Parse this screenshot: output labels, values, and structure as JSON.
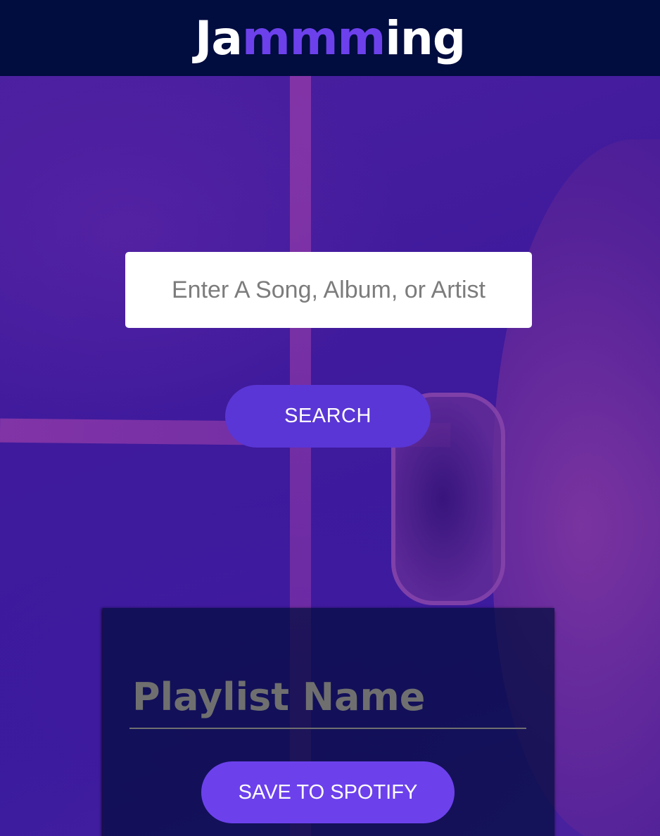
{
  "header": {
    "logo_prefix": "Ja",
    "logo_accent": "mmm",
    "logo_suffix": "ing"
  },
  "search": {
    "placeholder": "Enter A Song, Album, or Artist",
    "button_label": "SEARCH"
  },
  "playlist": {
    "name_placeholder": "Playlist Name",
    "save_label": "SAVE TO SPOTIFY"
  },
  "colors": {
    "header_bg": "#010c3f",
    "accent": "#6c41ec",
    "search_button": "#5a36d6",
    "hero_tint": "#3b1b9e"
  }
}
